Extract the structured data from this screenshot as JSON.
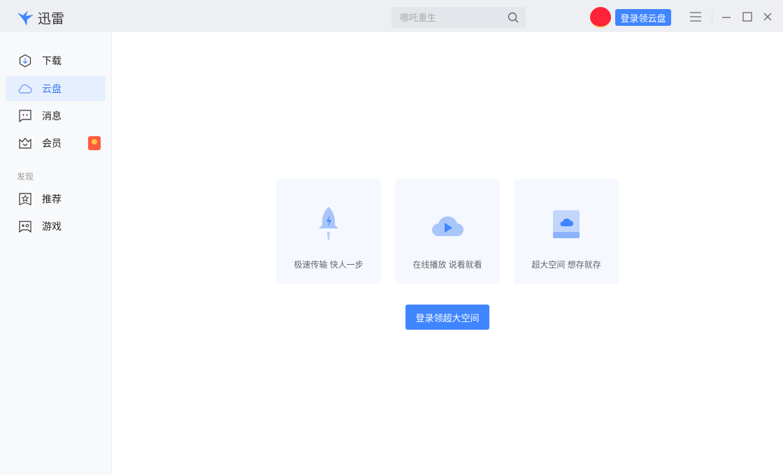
{
  "app": {
    "name": "迅雷"
  },
  "search": {
    "placeholder": "哪吒重生"
  },
  "header": {
    "login_button": "登录领云盘"
  },
  "sidebar": {
    "items": [
      {
        "label": "下载"
      },
      {
        "label": "云盘"
      },
      {
        "label": "消息"
      },
      {
        "label": "会员"
      }
    ],
    "section_label": "发现",
    "discover": [
      {
        "label": "推荐"
      },
      {
        "label": "游戏"
      }
    ]
  },
  "main": {
    "features": [
      {
        "label": "极速传输 快人一步"
      },
      {
        "label": "在线播放 说看就看"
      },
      {
        "label": "超大空间 想存就存"
      }
    ],
    "login_button": "登录领超大空间"
  },
  "colors": {
    "accent": "#3f85ff",
    "active_bg": "#e6effd"
  }
}
